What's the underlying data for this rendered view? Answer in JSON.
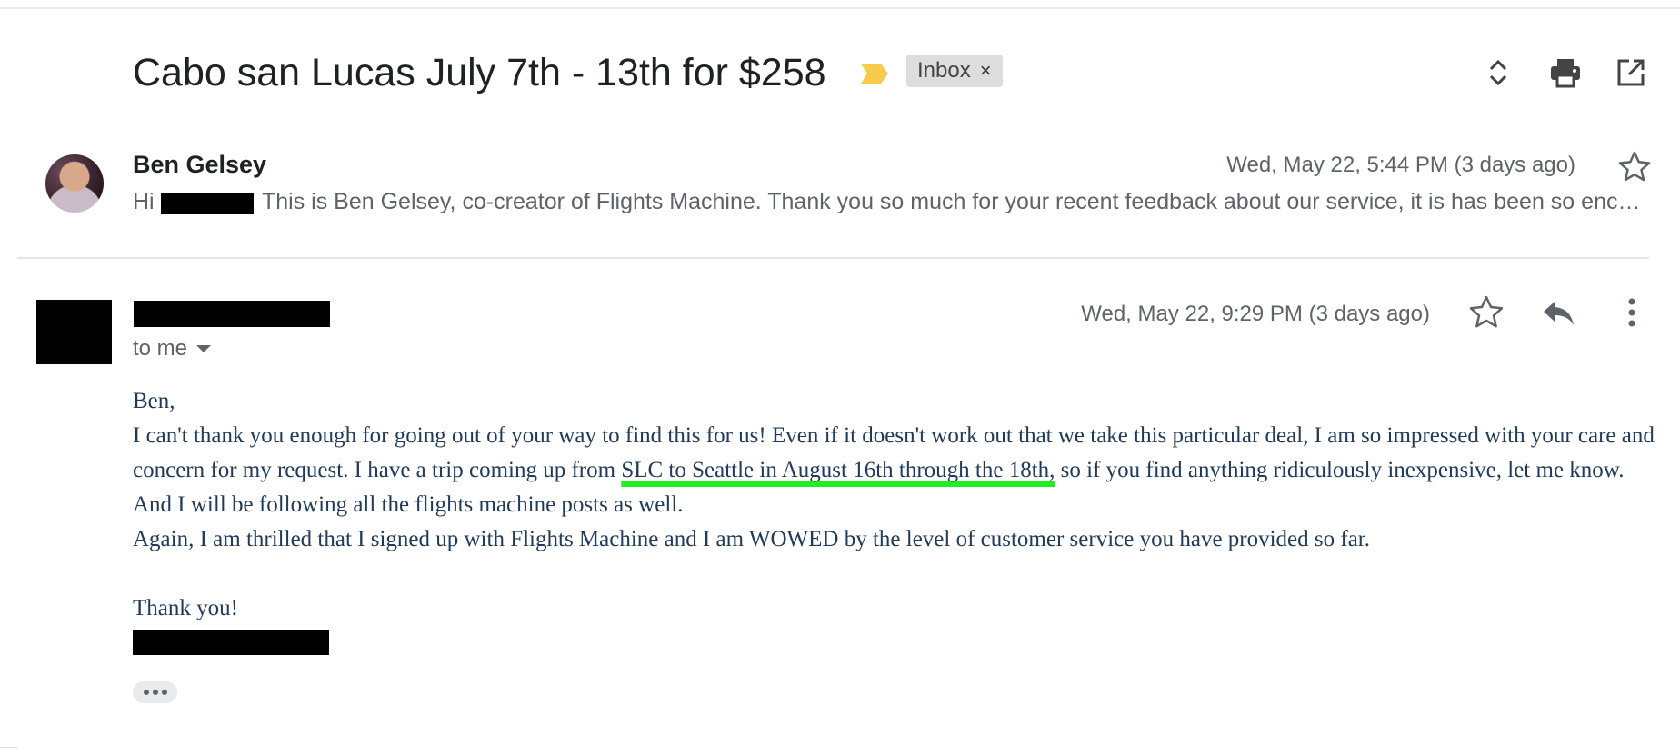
{
  "thread": {
    "subject": "Cabo san Lucas July 7th - 13th for $258",
    "label": "Inbox",
    "label_remove": "×",
    "icons": [
      "important-marker-icon",
      "expand-collapse-icon",
      "print-icon",
      "open-in-new-window-icon"
    ]
  },
  "message_collapsed": {
    "sender": "Ben Gelsey",
    "date": "Wed, May 22, 5:44 PM (3 days ago)",
    "snippet_greeting": "Hi",
    "snippet": "This is Ben Gelsey, co-creator of Flights Machine. Thank you so much for your recent feedback about our service, it is has been so encouraging to hear from users like yourself.",
    "icons": [
      "avatar",
      "star-icon"
    ]
  },
  "message_expanded": {
    "date": "Wed, May 22, 9:29 PM (3 days ago)",
    "to_line": "to me",
    "icons": [
      "star-icon",
      "reply-icon",
      "more-vert-icon",
      "expand-quoted-icon"
    ],
    "body": {
      "greeting": "Ben,",
      "p1_a": "I can't thank you enough for going out of your way to find this for us!  Even if it doesn't work out that we take this particular deal, I am so impressed with your care and concern for my request.  I have a trip coming up from ",
      "p1_highlight": "SLC to Seattle in August 16th through the 18th,",
      "p1_b": " so if you find anything ridiculously inexpensive, let me know.  And I will be following all the flights machine posts as well.",
      "p2": "Again, I am thrilled that I signed up with Flights Machine and I am WOWED by the level of customer service you have provided so far.",
      "closing": "Thank you!"
    }
  },
  "colors": {
    "body_text": "#1f3a5a",
    "highlight_underline": "#22ee22",
    "important_marker": "#f7cb4d",
    "label_chip": "#dddddd",
    "secondary_text": "#5f6368"
  }
}
